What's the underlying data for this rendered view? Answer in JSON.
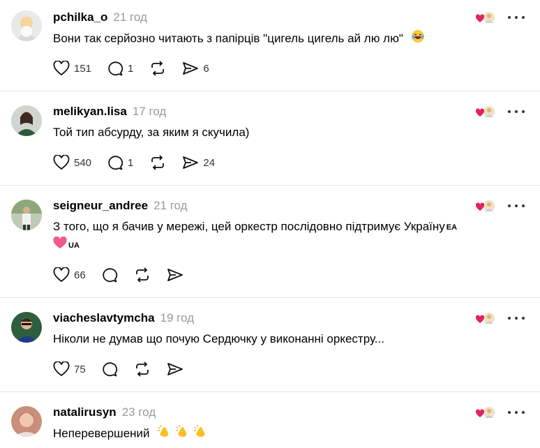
{
  "posts": [
    {
      "username": "pchilka_o",
      "time": "21 год",
      "text": "Вони так серйозно читають з папірців \"цигель цигель ай лю лю\"",
      "emoji": "laughing-face",
      "likes": "151",
      "replies": "1",
      "shares": "6",
      "avatar_color": "#e9e9e9"
    },
    {
      "username": "melikyan.lisa",
      "time": "17 год",
      "text": "Той тип абсурду, за яким я скучила)",
      "likes": "540",
      "replies": "1",
      "shares": "24",
      "avatar_color": "#cfd6cf"
    },
    {
      "username": "seigneur_andree",
      "time": "21 год",
      "text": "З того, що я бачив у мережі, цей оркестр послідовно підтримує Україну",
      "text_suffix": "EA",
      "line2_flag": "UA",
      "likes": "66",
      "avatar_color": "#bfcbb4"
    },
    {
      "username": "viacheslavtymcha",
      "time": "19 год",
      "text": "Ніколи не думав що почую Сердючку у виконанні оркестру...",
      "likes": "75",
      "avatar_color": "#2f5e3d"
    },
    {
      "username": "natalirusyn",
      "time": "23 год",
      "text": "Неперевершений",
      "emoji": "clapping-hands",
      "avatar_color": "#c98f7a"
    }
  ],
  "colors": {
    "divider": "#e6e6e6",
    "muted": "#999999",
    "heart": "#e0245e"
  }
}
